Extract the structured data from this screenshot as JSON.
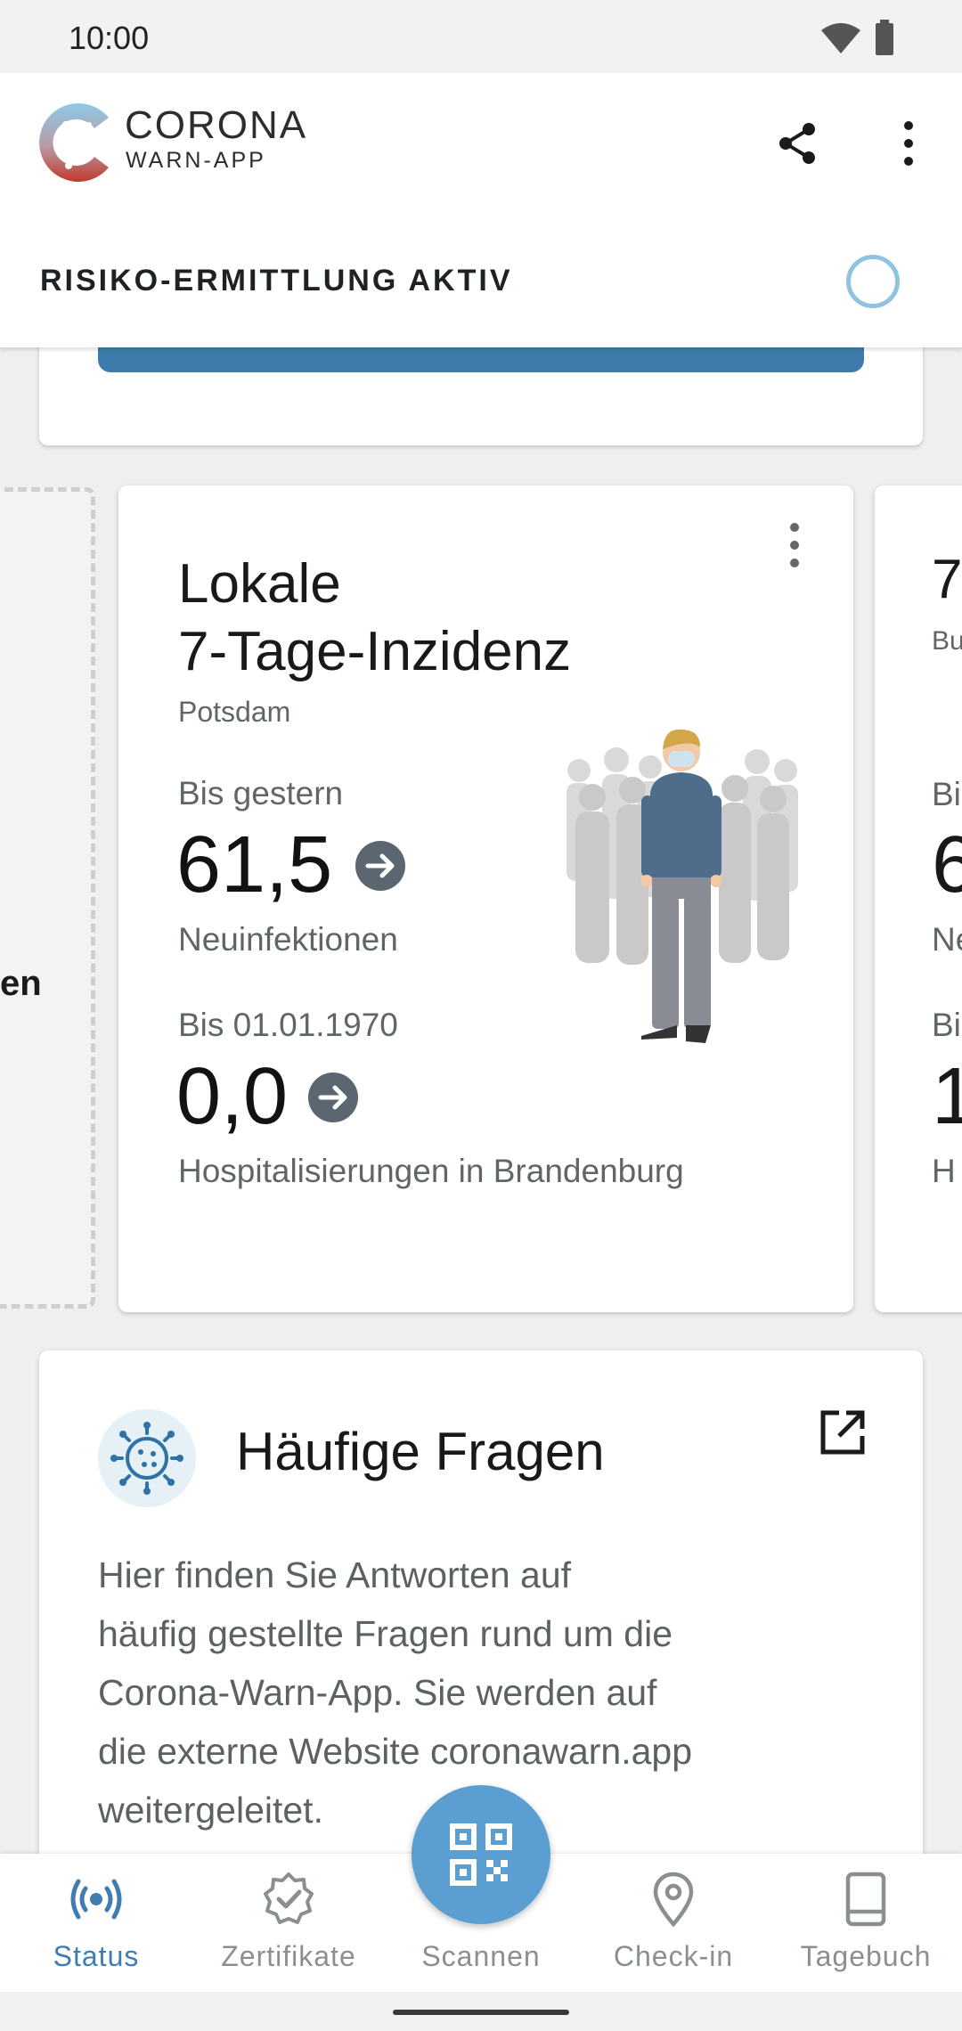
{
  "status_bar": {
    "time": "10:00"
  },
  "app_bar": {
    "logo_title": "CORONA",
    "logo_subtitle": "WARN-APP"
  },
  "risk": {
    "header": "RISIKO-ERMITTLUNG AKTIV"
  },
  "left_card": {
    "partial_text": "en"
  },
  "incidence_card": {
    "title_line1": "Lokale",
    "title_line2": "7-Tage-Inzidenz",
    "location": "Potsdam",
    "first": {
      "label": "Bis gestern",
      "value": "61,5",
      "caption": "Neuinfektionen"
    },
    "second": {
      "label": "Bis 01.01.1970",
      "value": "0,0",
      "caption": "Hospitalisierungen in Brandenburg"
    }
  },
  "right_card_partial": {
    "title": "7",
    "subtitle": "Bu",
    "label1": "Bi",
    "value1": "6",
    "caption1": "Ne",
    "label2": "Bi",
    "value2": "1",
    "caption2": "H"
  },
  "faq": {
    "title": "Häufige Fragen",
    "body_lines": [
      "Hier finden Sie Antworten auf",
      "häufig gestellte Fragen rund um die",
      "Corona-Warn-App. Sie werden auf",
      "die externe Website coronawarn.app",
      "weitergeleitet."
    ]
  },
  "bottom_nav": {
    "items": [
      {
        "label": "Status",
        "icon": "broadcast-icon",
        "active": true
      },
      {
        "label": "Zertifikate",
        "icon": "certificate-badge-icon",
        "active": false
      },
      {
        "label": "Scannen",
        "icon": "qr-code-icon",
        "active": false
      },
      {
        "label": "Check-in",
        "icon": "location-pin-icon",
        "active": false
      },
      {
        "label": "Tagebuch",
        "icon": "book-icon",
        "active": false
      }
    ]
  },
  "colors": {
    "accent": "#3f7db0",
    "fab": "#5b9fd2",
    "primary_button": "#3d7bad",
    "spinner": "#8fc3df",
    "arrow_badge": "#5b6670"
  }
}
